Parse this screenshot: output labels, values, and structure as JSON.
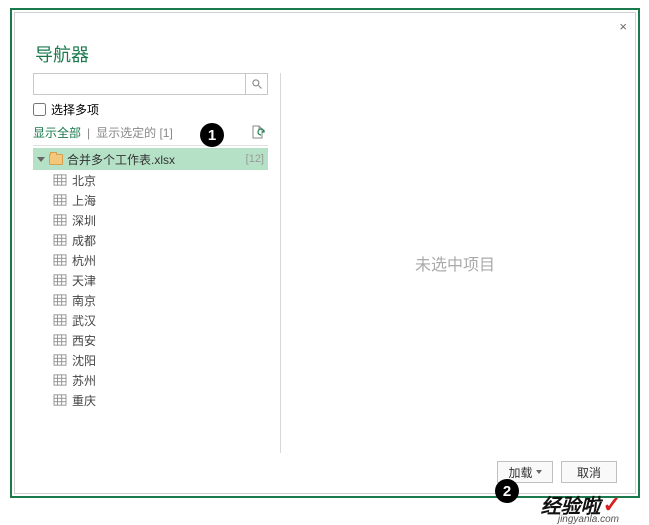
{
  "dialog": {
    "title": "导航器",
    "close": "×"
  },
  "search": {
    "placeholder": ""
  },
  "options": {
    "multiselect_label": "选择多项"
  },
  "filter": {
    "show_all": "显示全部",
    "separator": "|",
    "show_selected": "显示选定的 [1]"
  },
  "tree": {
    "root_label": "合并多个工作表.xlsx",
    "root_count": "[12]",
    "items": [
      {
        "label": "北京"
      },
      {
        "label": "上海"
      },
      {
        "label": "深圳"
      },
      {
        "label": "成都"
      },
      {
        "label": "杭州"
      },
      {
        "label": "天津"
      },
      {
        "label": "南京"
      },
      {
        "label": "武汉"
      },
      {
        "label": "西安"
      },
      {
        "label": "沈阳"
      },
      {
        "label": "苏州"
      },
      {
        "label": "重庆"
      }
    ]
  },
  "preview": {
    "placeholder": "未选中项目"
  },
  "buttons": {
    "load": "加载",
    "cancel": "取消"
  },
  "annotations": {
    "badge1": "1",
    "badge2": "2"
  },
  "watermark": {
    "brand": "经验啦",
    "check": "✓",
    "url": "jingyanla.com"
  }
}
